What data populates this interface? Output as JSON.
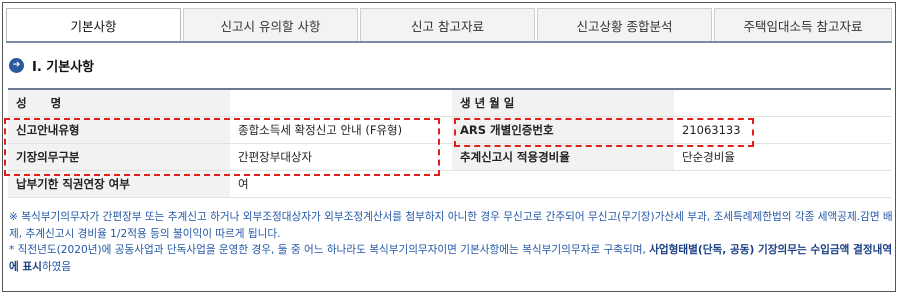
{
  "tabs": [
    {
      "label": "기본사항",
      "active": true
    },
    {
      "label": "신고시 유의할 사항",
      "active": false
    },
    {
      "label": "신고 참고자료",
      "active": false
    },
    {
      "label": "신고상황 종합분석",
      "active": false
    },
    {
      "label": "주택임대소득 참고자료",
      "active": false
    }
  ],
  "section": {
    "icon": "circle-arrow-icon",
    "title": "Ⅰ. 기본사항"
  },
  "info": {
    "name_label": "성      명",
    "name_value": "",
    "birth_label": "생 년 월 일",
    "birth_value": "",
    "report_type_label": "신고안내유형",
    "report_type_value": "종합소득세 확정신고 안내 (F유형)",
    "ars_label": "ARS 개별인증번호",
    "ars_value": "21063133",
    "bookkeeping_label": "기장의무구분",
    "bookkeeping_value": "간편장부대상자",
    "expense_rate_label": "추계신고시 적용경비율",
    "expense_rate_value": "단순경비율",
    "deferral_label": "납부기한 직권연장 여부",
    "deferral_value": "여"
  },
  "notes": {
    "note1": "※ 복식부기의무자가 간편장부 또는 추계신고 하거나 외부조정대상자가 외부조정계산서를 첨부하지 아니한 경우 무신고로 간주되어 무신고(무기장)가산세 부과, 조세특례제한법의 각종 세액공제.감면 배제, 추계신고시 경비율 1/2적용 등의 불이익이 따르게 됩니다.",
    "note2_prefix": "* 직전년도(2020년)에 공동사업과 단독사업을 운영한 경우, 둘 중 어느 하나라도 복식부기의무자이면 기본사항에는 복식부기의무자로 구축되며, ",
    "note2_bold": "사업형태별(단독, 공동) 기장의무는 수입금액 결정내역에 표시",
    "note2_suffix": "하였음"
  },
  "colors": {
    "highlight": "#e0201a",
    "section_icon": "#2c5a9e",
    "note_text": "#2458a8"
  }
}
